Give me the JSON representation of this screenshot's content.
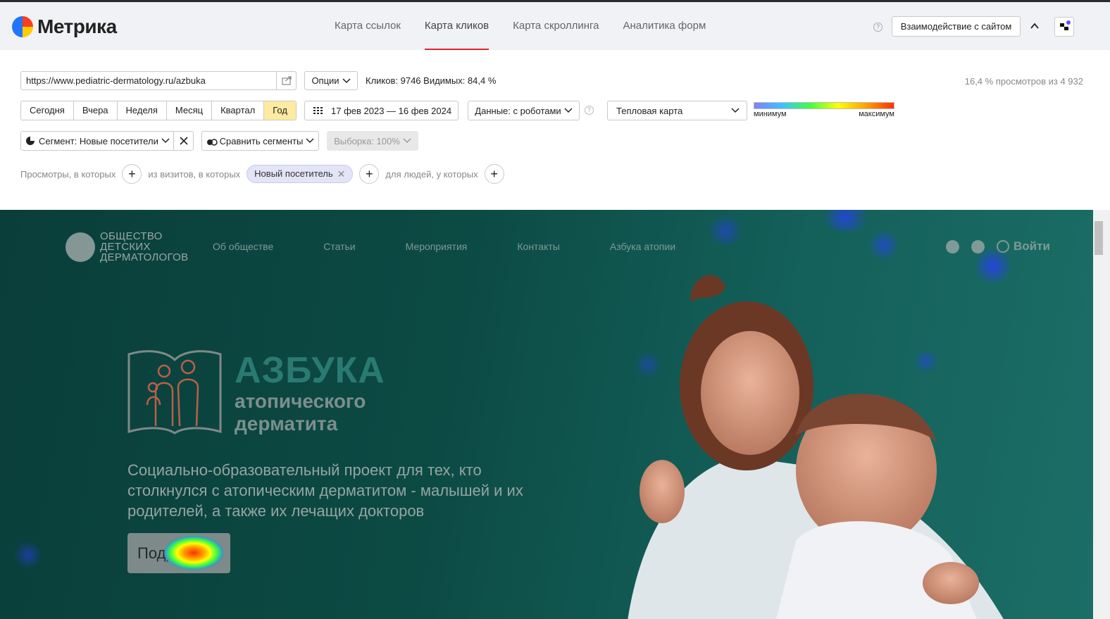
{
  "colors": {
    "accent": "#e0252a",
    "active_period": "#ffeba0",
    "chip_bg": "#e3e4f7",
    "site_bg": "#0c4a44"
  },
  "app": {
    "name": "Метрика"
  },
  "nav": [
    {
      "label": "Карта ссылок",
      "active": false
    },
    {
      "label": "Карта кликов",
      "active": true
    },
    {
      "label": "Карта скроллинга",
      "active": false
    },
    {
      "label": "Аналитика форм",
      "active": false
    }
  ],
  "header_right": {
    "interact_label": "Взаимодействие с сайтом",
    "help_icon": "question-icon"
  },
  "toolbar": {
    "url": "https://www.pediatric-dermatology.ru/azbuka",
    "options_label": "Опции",
    "stats": "Кликов: 9746  Видимых: 84,4 %",
    "views_summary": "16,4 % просмотров из 4 932"
  },
  "periods": [
    {
      "label": "Сегодня",
      "active": false
    },
    {
      "label": "Вчера",
      "active": false
    },
    {
      "label": "Неделя",
      "active": false
    },
    {
      "label": "Месяц",
      "active": false
    },
    {
      "label": "Квартал",
      "active": false
    },
    {
      "label": "Год",
      "active": true
    }
  ],
  "date_range": "17 фев 2023 — 16 фев 2024",
  "data_select": "Данные: с роботами",
  "map_type": "Тепловая карта",
  "legend": {
    "min": "минимум",
    "max": "максимум"
  },
  "segment": {
    "label": "Сегмент: Новые посетители",
    "compare_label": "Сравнить сегменты",
    "sample_label": "Выборка: 100%"
  },
  "filters": {
    "views": "Просмотры, в которых",
    "visits": "из визитов, в которых",
    "chip": "Новый посетитель",
    "people": "для людей, у которых"
  },
  "site": {
    "logo_lines": [
      "ОБЩЕСТВО",
      "ДЕТСКИХ",
      "ДЕРМАТОЛОГОВ"
    ],
    "nav": [
      "Об обществе",
      "Статьи",
      "Мероприятия",
      "Контакты",
      "Азбука атопии"
    ],
    "login": "Войти",
    "title": "АЗБУКА",
    "subtitle1": "атопического",
    "subtitle2": "дерматита",
    "description": "Социально-образовательный проект для тех, кто столкнулся с атопическим дерматитом - малышей и их родителей, а также их лечащих докторов",
    "more_button": "Подробнее"
  }
}
